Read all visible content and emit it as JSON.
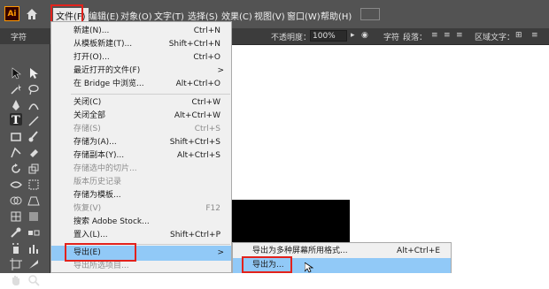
{
  "app": {
    "logo": "Ai"
  },
  "menubar": {
    "items": [
      "文件(F)",
      "编辑(E)",
      "对象(O)",
      "文字(T)",
      "选择(S)",
      "效果(C)",
      "视图(V)",
      "窗口(W)",
      "帮助(H)"
    ],
    "active": "文件(F)"
  },
  "controlbar": {
    "label_left": "字符",
    "opacity_label": "不透明度：",
    "opacity_value": "100%",
    "char_label": "字符",
    "para_label": "段落：",
    "area_label": "区域文字："
  },
  "file_menu": {
    "items": [
      {
        "label": "新建(N)...",
        "shortcut": "Ctrl+N",
        "disabled": false
      },
      {
        "label": "从模板新建(T)...",
        "shortcut": "Shift+Ctrl+N",
        "disabled": false
      },
      {
        "label": "打开(O)...",
        "shortcut": "Ctrl+O",
        "disabled": false
      },
      {
        "label": "最近打开的文件(F)",
        "shortcut": ">",
        "disabled": false
      },
      {
        "label": "在 Bridge 中浏览...",
        "shortcut": "Alt+Ctrl+O",
        "disabled": false
      },
      {
        "label": "关闭(C)",
        "shortcut": "Ctrl+W",
        "disabled": false
      },
      {
        "label": "关闭全部",
        "shortcut": "Alt+Ctrl+W",
        "disabled": false
      },
      {
        "label": "存储(S)",
        "shortcut": "Ctrl+S",
        "disabled": true
      },
      {
        "label": "存储为(A)...",
        "shortcut": "Shift+Ctrl+S",
        "disabled": false
      },
      {
        "label": "存储副本(Y)...",
        "shortcut": "Alt+Ctrl+S",
        "disabled": false
      },
      {
        "label": "存储选中的切片...",
        "shortcut": "",
        "disabled": true
      },
      {
        "label": "版本历史记录",
        "shortcut": "",
        "disabled": true
      },
      {
        "label": "存储为模板...",
        "shortcut": "",
        "disabled": false
      },
      {
        "label": "恢复(V)",
        "shortcut": "F12",
        "disabled": true
      },
      {
        "label": "搜索 Adobe Stock...",
        "shortcut": "",
        "disabled": false
      },
      {
        "label": "置入(L)...",
        "shortcut": "Shift+Ctrl+P",
        "disabled": false
      },
      {
        "label": "导出(E)",
        "shortcut": ">",
        "disabled": false
      },
      {
        "label": "导出所选项目...",
        "shortcut": "",
        "disabled": true
      }
    ]
  },
  "export_submenu": {
    "items": [
      {
        "label": "导出为多种屏幕所用格式...",
        "shortcut": "Alt+Ctrl+E"
      },
      {
        "label": "导出为...",
        "shortcut": ""
      }
    ]
  },
  "icons": [
    "home-icon",
    "selection-tool-icon",
    "direct-selection-tool-icon",
    "pen-tool-icon",
    "type-tool-icon",
    "hand-tool-icon",
    "zoom-tool-icon"
  ]
}
